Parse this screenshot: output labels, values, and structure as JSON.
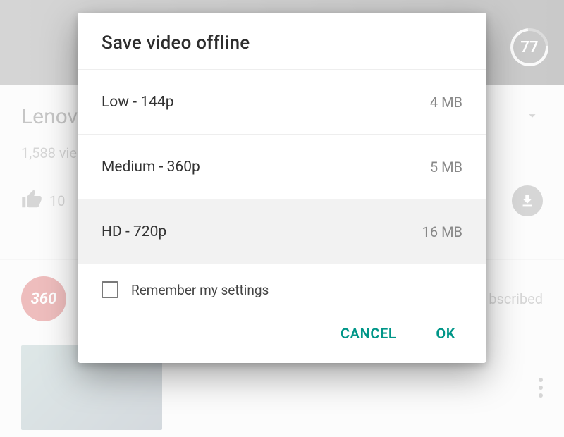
{
  "background": {
    "timer_value": "77",
    "video_title_partial": "Lenov",
    "views_partial": "1,588 vie",
    "like_count": "10",
    "channel_logo_text": "360",
    "subscribed_partial": "bscribed"
  },
  "dialog": {
    "title": "Save video offline",
    "options": [
      {
        "label": "Low - 144p",
        "size": "4 MB",
        "selected": false
      },
      {
        "label": "Medium - 360p",
        "size": "5 MB",
        "selected": false
      },
      {
        "label": "HD - 720p",
        "size": "16 MB",
        "selected": true
      }
    ],
    "remember_label": "Remember my settings",
    "remember_checked": false,
    "cancel_label": "CANCEL",
    "ok_label": "OK"
  },
  "colors": {
    "accent": "#009688"
  }
}
